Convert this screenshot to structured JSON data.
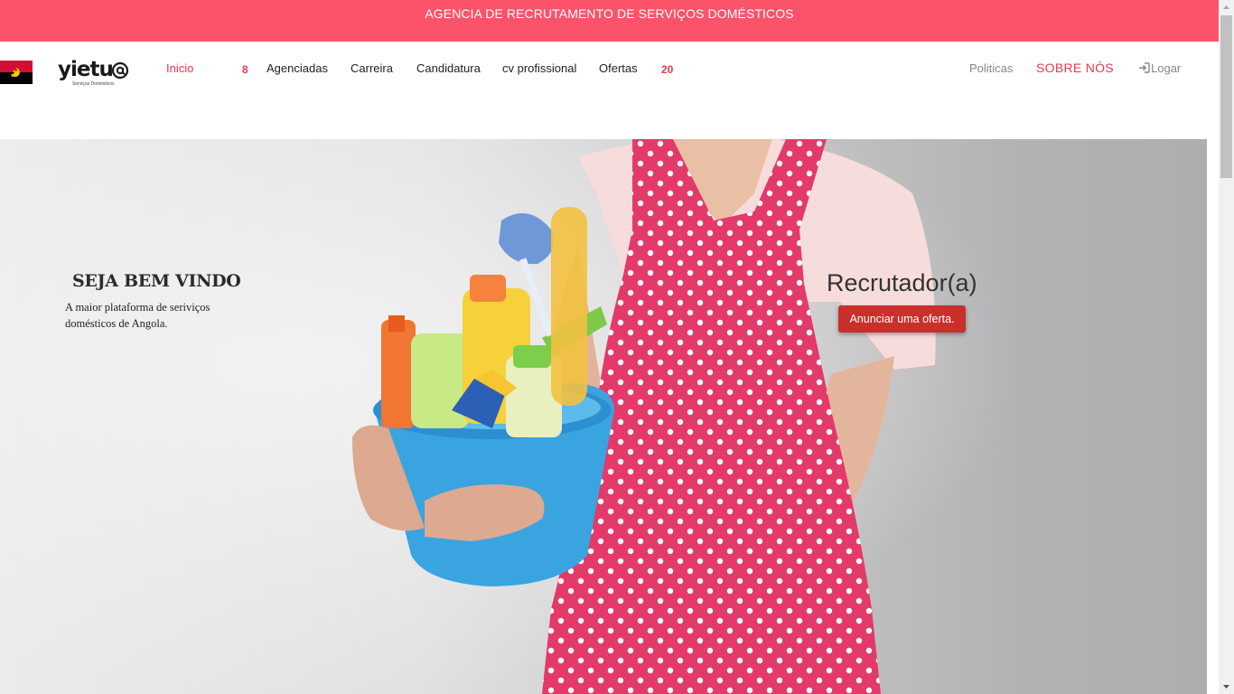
{
  "banner": {
    "text": "AGENCIA DE RECRUTAMENTO DE SERVIÇOS DOMÉSTICOS"
  },
  "brand": {
    "name": "yietu",
    "subtitle": "Serviços Domésticos"
  },
  "nav": {
    "home": "Inicio",
    "agency_count": "8",
    "agencies": "Agenciadas",
    "career": "Carreira",
    "application": "Candidatura",
    "cv": "cv profissional",
    "offers": "Ofertas",
    "offers_count": "20",
    "policies": "Politicas",
    "about": "SOBRE NÓS",
    "login": "Logar"
  },
  "hero": {
    "welcome_title": "SEJA BEM VINDO",
    "welcome_text": "A maior plataforma de seriviços domésticos de Angola.",
    "recruiter_title": "Recrutador(a)",
    "offer_button": "Anunciar uma oferta."
  },
  "colors": {
    "brand_pink": "#fb5369",
    "accent_red": "#e8384f",
    "button_red": "#c9302c",
    "flag_red": "#d21034",
    "flag_black": "#000000",
    "flag_yellow": "#ffcb00"
  },
  "icons": {
    "flag": "angola-flag-icon",
    "login": "sign-in-icon"
  }
}
